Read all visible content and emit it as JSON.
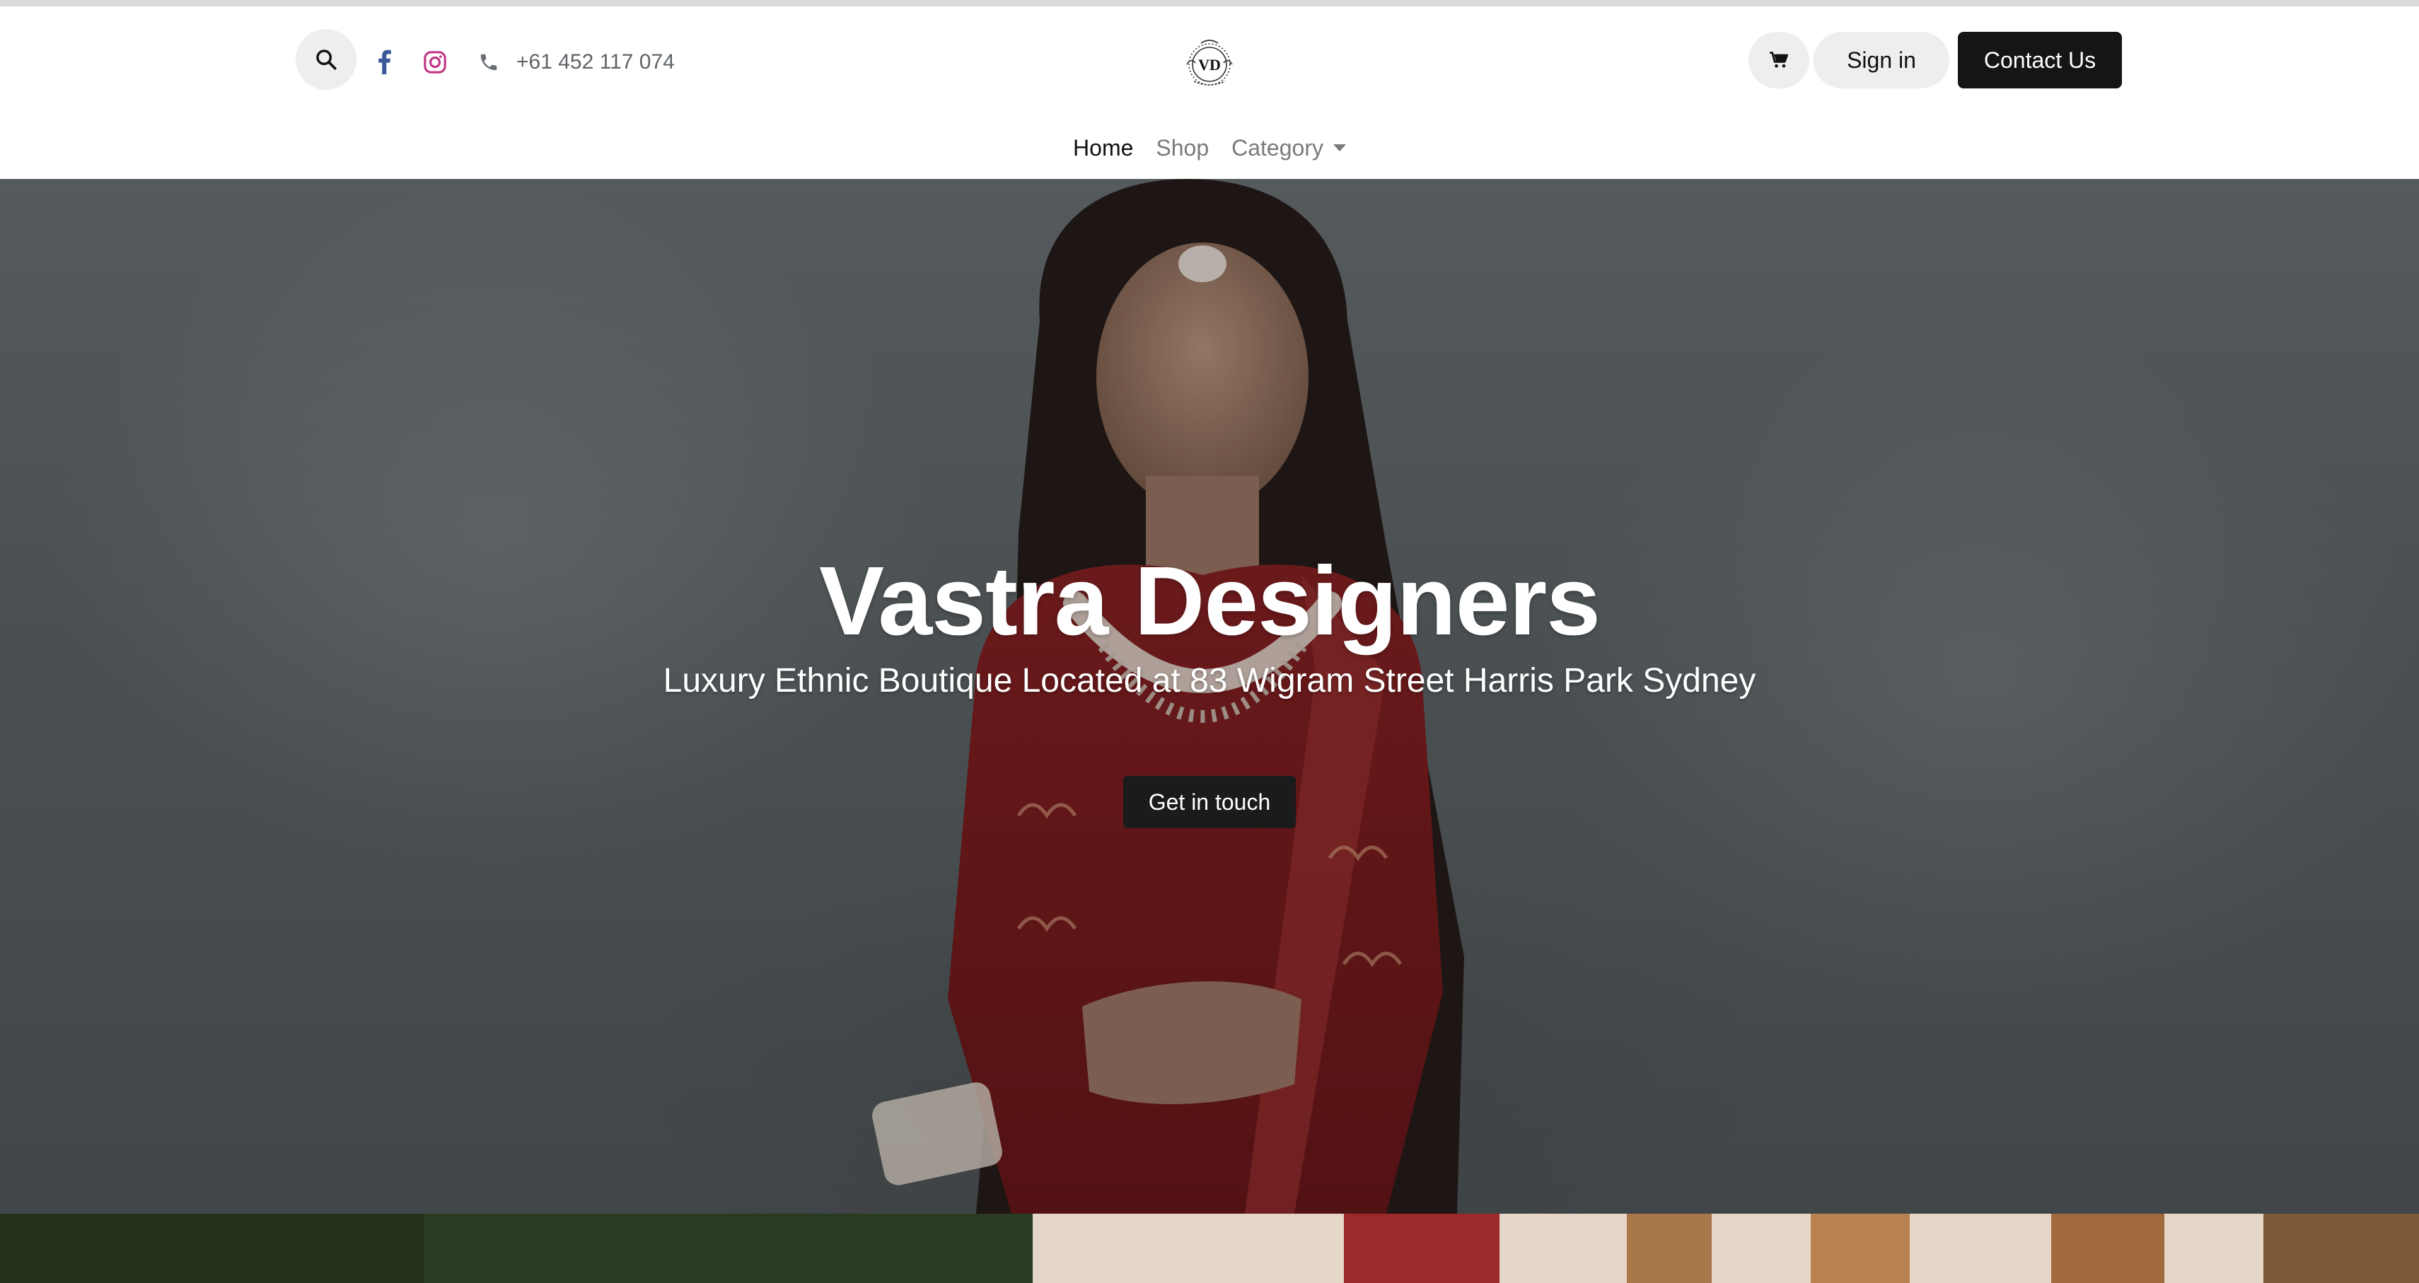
{
  "header": {
    "phone": "+61 452 117 074",
    "logo_text": "VD",
    "sign_in_label": "Sign in",
    "contact_label": "Contact Us"
  },
  "nav": {
    "items": [
      {
        "label": "Home",
        "active": true
      },
      {
        "label": "Shop",
        "active": false
      },
      {
        "label": "Category",
        "active": false,
        "dropdown": true
      }
    ]
  },
  "hero": {
    "title": "Vastra Designers",
    "subtitle": "Luxury Ethnic Boutique Located at 83 Wigram Street Harris Park Sydney",
    "cta_label": "Get in touch"
  },
  "icons": {
    "search": "search-icon",
    "facebook": "facebook-icon",
    "instagram": "instagram-icon",
    "phone": "phone-icon",
    "cart": "cart-icon"
  },
  "colors": {
    "primary_button": "#151515",
    "facebook": "#3b5998",
    "instagram": "#c13584",
    "nav_muted": "#7a7a7a"
  }
}
